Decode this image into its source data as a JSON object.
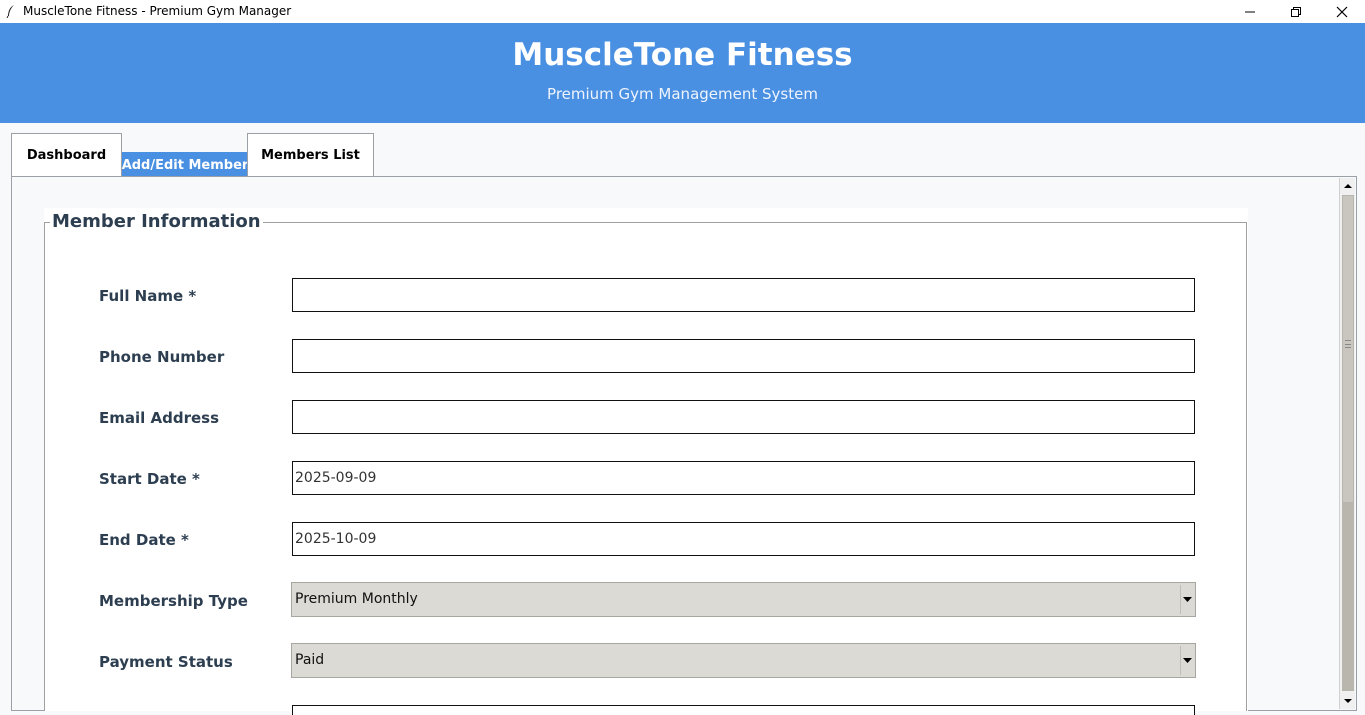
{
  "window": {
    "title": "MuscleTone Fitness - Premium Gym Manager"
  },
  "header": {
    "title": "MuscleTone Fitness",
    "subtitle": "Premium Gym Management System"
  },
  "tabs": [
    {
      "label": "Dashboard",
      "selected": false
    },
    {
      "label": "Add/Edit Member",
      "selected": true
    },
    {
      "label": "Members List",
      "selected": false
    }
  ],
  "form": {
    "legend": "Member Information",
    "fields": [
      {
        "label": "Full Name *",
        "value": ""
      },
      {
        "label": "Phone Number",
        "value": ""
      },
      {
        "label": "Email Address",
        "value": ""
      },
      {
        "label": "Start Date *",
        "value": "2025-09-09"
      },
      {
        "label": "End Date *",
        "value": "2025-10-09"
      },
      {
        "label": "Membership Type",
        "value": "Premium Monthly"
      },
      {
        "label": "Payment Status",
        "value": "Paid"
      }
    ]
  },
  "colors": {
    "header_bg": "#4a90e2",
    "selected_tab_bg": "#4a90e2",
    "label_text": "#2c3e50",
    "combo_bg": "#dcdad5"
  },
  "icons": {
    "app": "feather-icon",
    "minimize": "minimize-icon",
    "maximize": "restore-icon",
    "close": "close-icon",
    "dropdown": "chevron-down-icon"
  }
}
